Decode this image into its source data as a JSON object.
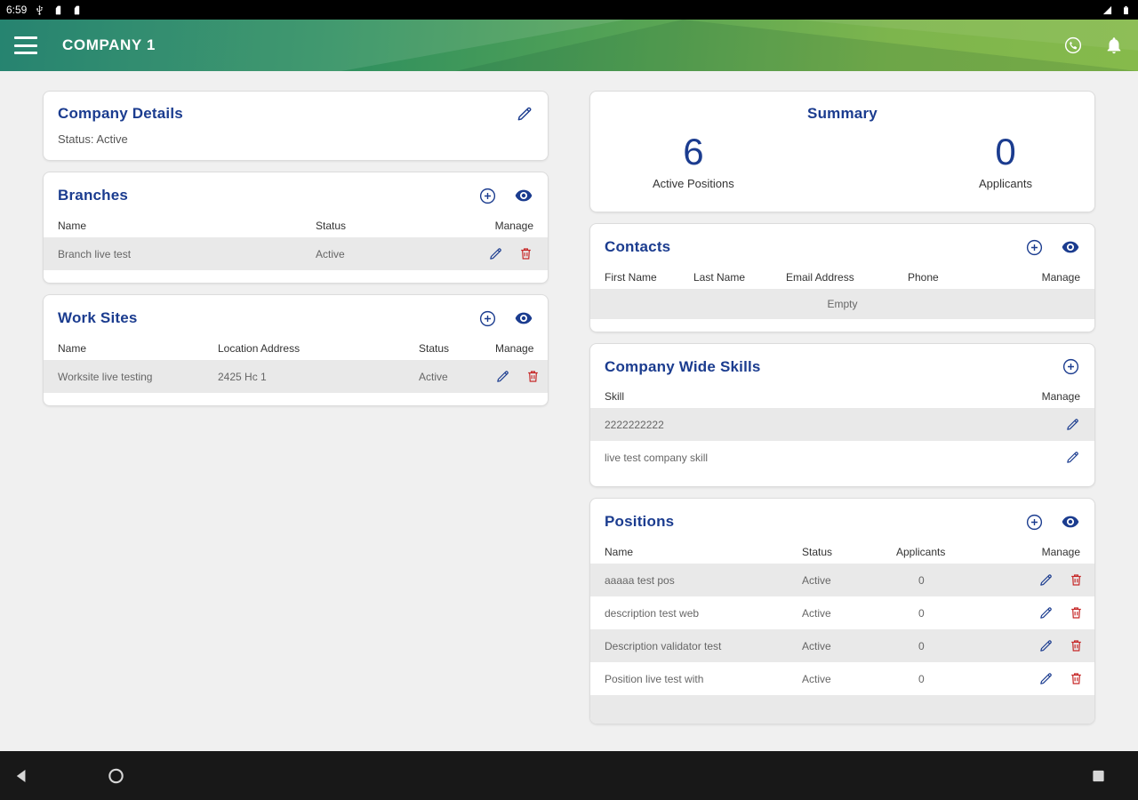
{
  "colors": {
    "primary_blue": "#1b3c8f",
    "danger_red": "#c62828",
    "appbar_gradient_start": "#0e7660",
    "appbar_gradient_end": "#86ba4b",
    "row_gray": "#e9e9e9"
  },
  "status_bar": {
    "time": "6:59"
  },
  "app_bar": {
    "title": "COMPANY 1"
  },
  "company_details": {
    "title": "Company Details",
    "status": "Status: Active"
  },
  "branches": {
    "title": "Branches",
    "headers": [
      "Name",
      "Status",
      "Manage"
    ],
    "rows": [
      {
        "name": "Branch live test",
        "status": "Active"
      }
    ]
  },
  "work_sites": {
    "title": "Work Sites",
    "headers": [
      "Name",
      "Location Address",
      "Status",
      "Manage"
    ],
    "rows": [
      {
        "name": "Worksite live testing",
        "location": "2425 Hc 1",
        "status": "Active"
      }
    ]
  },
  "summary": {
    "title": "Summary",
    "stats": [
      {
        "value": "6",
        "label": "Active Positions"
      },
      {
        "value": "0",
        "label": "Applicants"
      }
    ]
  },
  "contacts": {
    "title": "Contacts",
    "headers": [
      "First Name",
      "Last Name",
      "Email Address",
      "Phone",
      "Manage"
    ],
    "empty": "Empty"
  },
  "skills": {
    "title": "Company Wide Skills",
    "headers": [
      "Skill",
      "Manage"
    ],
    "rows": [
      {
        "skill": "2222222222"
      },
      {
        "skill": "live test company skill"
      }
    ]
  },
  "positions": {
    "title": "Positions",
    "headers": [
      "Name",
      "Status",
      "Applicants",
      "Manage"
    ],
    "rows": [
      {
        "name": "aaaaa test pos",
        "status": "Active",
        "applicants": "0"
      },
      {
        "name": "description test web",
        "status": "Active",
        "applicants": "0"
      },
      {
        "name": "Description validator test",
        "status": "Active",
        "applicants": "0"
      },
      {
        "name": "Position live test with",
        "status": "Active",
        "applicants": "0"
      }
    ]
  }
}
